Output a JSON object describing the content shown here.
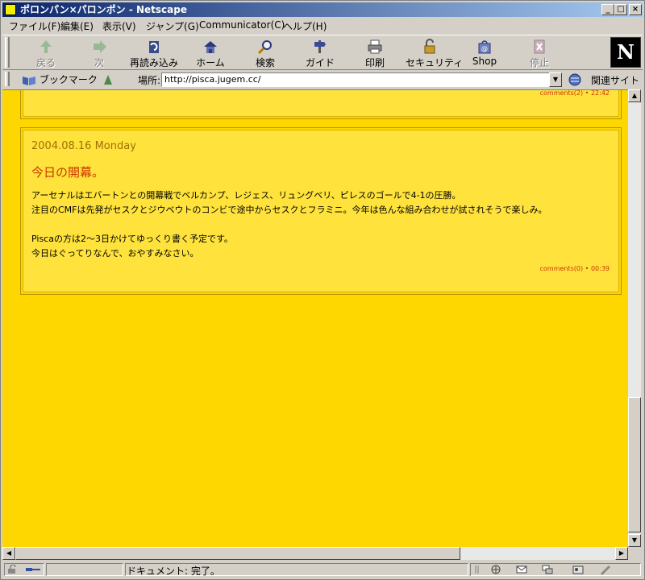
{
  "window": {
    "title": "ポロンパン×パロンポン - Netscape"
  },
  "menu": [
    "ファイル(F)",
    "編集(E)",
    "表示(V)",
    "ジャンプ(G)",
    "Communicator(C)",
    "ヘルプ(H)"
  ],
  "toolbar": [
    {
      "label": "戻る",
      "icon": "back-arrow-icon",
      "enabled": false
    },
    {
      "label": "次",
      "icon": "forward-arrow-icon",
      "enabled": false
    },
    {
      "label": "再読み込み",
      "icon": "reload-icon",
      "enabled": true
    },
    {
      "label": "ホーム",
      "icon": "home-icon",
      "enabled": true
    },
    {
      "label": "検索",
      "icon": "search-icon",
      "enabled": true
    },
    {
      "label": "ガイド",
      "icon": "guide-icon",
      "enabled": true
    },
    {
      "label": "印刷",
      "icon": "printer-icon",
      "enabled": true
    },
    {
      "label": "セキュリティ",
      "icon": "lock-icon",
      "enabled": true
    },
    {
      "label": "Shop",
      "icon": "shop-bag-icon",
      "enabled": true
    },
    {
      "label": "停止",
      "icon": "stop-icon",
      "enabled": false
    }
  ],
  "location": {
    "bookmark_label": "ブックマーク",
    "label": "場所:",
    "url": "http://pisca.jugem.cc/",
    "related_label": "関連サイト"
  },
  "posts": [
    {
      "meta": "comments(2) • 22:42"
    },
    {
      "date": "2004.08.16 Monday",
      "title": "今日の開幕。",
      "body": [
        "アーセナルはエバートンとの開幕戦でベルカンプ、レジェス、リュングベリ、ピレスのゴールで4-1の圧勝。",
        "注目のCMFは先発がセスクとジウベウトのコンビで途中からセスクとフラミニ。今年は色んな組み合わせが試されそうで楽しみ。",
        "",
        "Piscaの方は2〜3日かけてゆっくり書く予定です。",
        "今日はぐってりなんで、おやすみなさい。"
      ],
      "meta": "comments(0) • 00:39"
    }
  ],
  "status": {
    "text": "ドキュメント: 完了。"
  },
  "colors": {
    "page_bg": "#ffd700",
    "post_bg": "#ffe33c",
    "title": "#cc3300",
    "date": "#a07000",
    "titlebar": "#0a246a"
  }
}
